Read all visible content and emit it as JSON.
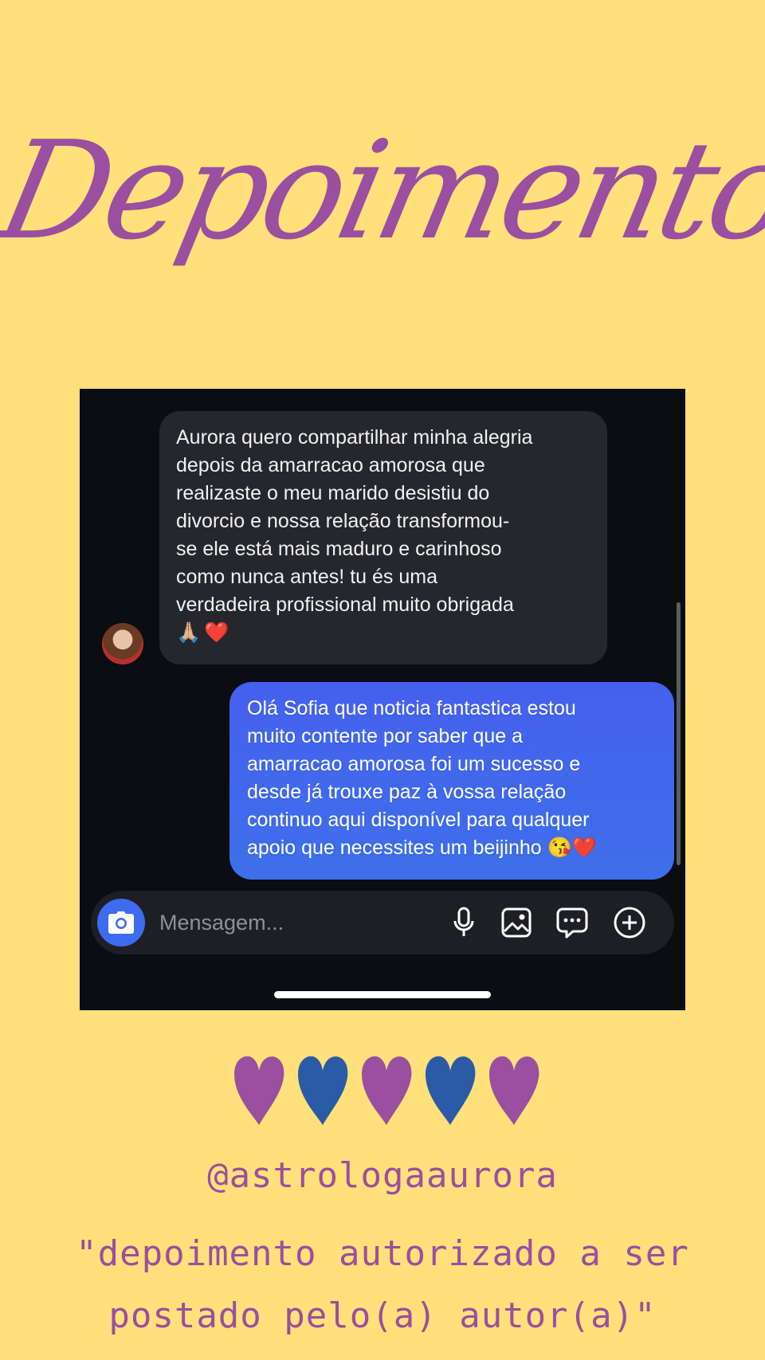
{
  "title": "Depoimentos",
  "chat": {
    "incoming": {
      "text": "Aurora quero compartilhar minha alegria\ndepois da amarracao amorosa que\nrealizaste o meu marido desistiu do\ndivorcio e nossa relação transformou-\nse ele está mais maduro e carinhoso\ncomo nunca antes! tu és uma\nverdadeira profissional muito obrigada",
      "emojis": [
        "🙏🏼",
        "❤️"
      ]
    },
    "outgoing": {
      "text": "Olá Sofia que noticia fantastica estou\nmuito contente por saber que a\namarracao amorosa foi um sucesso e\ndesde já trouxe paz à vossa relação\ncontinuo aqui disponível para qualquer\napoio que necessites um beijinho 😘❤️"
    },
    "composer": {
      "placeholder": "Mensagem..."
    }
  },
  "colors": {
    "background": "#FFE07A",
    "accent_purple": "#9A4FA0",
    "accent_blue": "#2B5AA6",
    "outgoing_bubble": "#4163EE",
    "incoming_bubble": "#25272C"
  },
  "hearts": [
    {
      "color": "#9A4FA0"
    },
    {
      "color": "#2B5AA6"
    },
    {
      "color": "#9A4FA0"
    },
    {
      "color": "#2B5AA6"
    },
    {
      "color": "#9A4FA0"
    }
  ],
  "footer": {
    "handle": "@astrologaaurora",
    "caption_line1": "\"depoimento autorizado a ser",
    "caption_line2": "postado pelo(a) autor(a)\""
  }
}
